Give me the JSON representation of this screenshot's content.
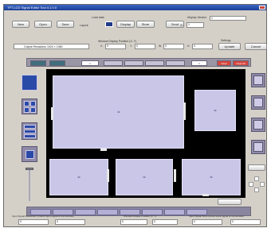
{
  "window": {
    "title": "TFT-LCD Signal Editor Tool 4.1.0.0"
  },
  "toolbar": {
    "buttons": [
      "New",
      "Open",
      "Save",
      "Load data",
      "Display",
      "Store",
      "Send"
    ],
    "layout_label": "Layout",
    "id_label": "ID",
    "id_value": "1",
    "config_label": "Configuration",
    "display_label": "Display Version",
    "display_value": "1",
    "right_label": "Settings",
    "right_buttons": [
      "Update",
      "Cancel"
    ]
  },
  "resolution": {
    "field_value": "Output Resolution 1920 × 1080",
    "section_label": "Window Display Position (X, Y)",
    "x_label": "X",
    "x_value": "0",
    "y_label": "Y",
    "y_value": "0",
    "w_label": "W",
    "w_value": "0",
    "h_label": "H",
    "h_value": "0"
  },
  "strip": {
    "page_value": "1",
    "count_value": "1",
    "red_labels": [
      "Clear",
      "Clear All"
    ]
  },
  "display": {},
  "status": {
    "left_label": "Input Signal Resolution (Check Input signal of the window)",
    "left_values": [
      "0",
      "0"
    ],
    "mid_label": "Window Display Position (X, Y)",
    "mid_values": [
      "0",
      "0"
    ],
    "right_label": "Input Signal Size (Check Input signal of the window)",
    "right_values": [
      "0",
      "0"
    ]
  },
  "colors": {
    "screen": "#c9c6e8",
    "accent_red": "#d8463c",
    "accent_teal": "#3f6f7c",
    "side_blue": "#2a4aa8"
  }
}
